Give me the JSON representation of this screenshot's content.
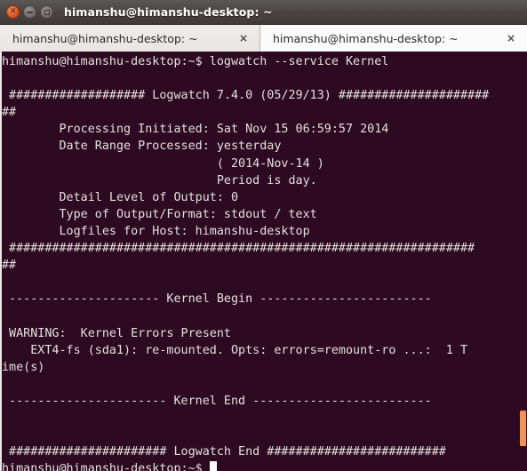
{
  "window": {
    "title": "himanshu@himanshu-desktop: ~",
    "buttons": {
      "close": "close-button",
      "minimize": "minimize-button",
      "maximize": "maximize-button"
    }
  },
  "tabs": [
    {
      "label": "himanshu@himanshu-desktop: ~",
      "close": "×",
      "active": false
    },
    {
      "label": "himanshu@himanshu-desktop: ~",
      "close": "×",
      "active": true
    }
  ],
  "terminal": {
    "prompt": "himanshu@himanshu-desktop:~$",
    "command": "logwatch --service Kernel",
    "cursor": "block-cursor",
    "lines": [
      "himanshu@himanshu-desktop:~$ logwatch --service Kernel",
      "",
      " ################### Logwatch 7.4.0 (05/29/13) #####################",
      "##",
      "        Processing Initiated: Sat Nov 15 06:59:57 2014",
      "        Date Range Processed: yesterday",
      "                              ( 2014-Nov-14 )",
      "                              Period is day.",
      "        Detail Level of Output: 0",
      "        Type of Output/Format: stdout / text",
      "        Logfiles for Host: himanshu-desktop",
      " #################################################################",
      "##",
      "",
      " --------------------- Kernel Begin ------------------------",
      "",
      " WARNING:  Kernel Errors Present",
      "    EXT4-fs (sda1): re-mounted. Opts: errors=remount-ro ...:  1 T",
      "ime(s)",
      "",
      " ---------------------- Kernel End -------------------------",
      "",
      "",
      " ###################### Logwatch End #########################"
    ],
    "final_prompt": "himanshu@himanshu-desktop:~$ "
  },
  "scrollbar": {
    "name": "vertical-scrollbar",
    "thumb_color": "#f0935a"
  },
  "colors": {
    "terminal_background": "#2d0a22",
    "terminal_text": "#e3e0dd",
    "titlebar": "#4a4543",
    "tab_active": "#fbfafa",
    "tab_inactive": "#e8e5e3",
    "accent_orange": "#e0592b"
  }
}
